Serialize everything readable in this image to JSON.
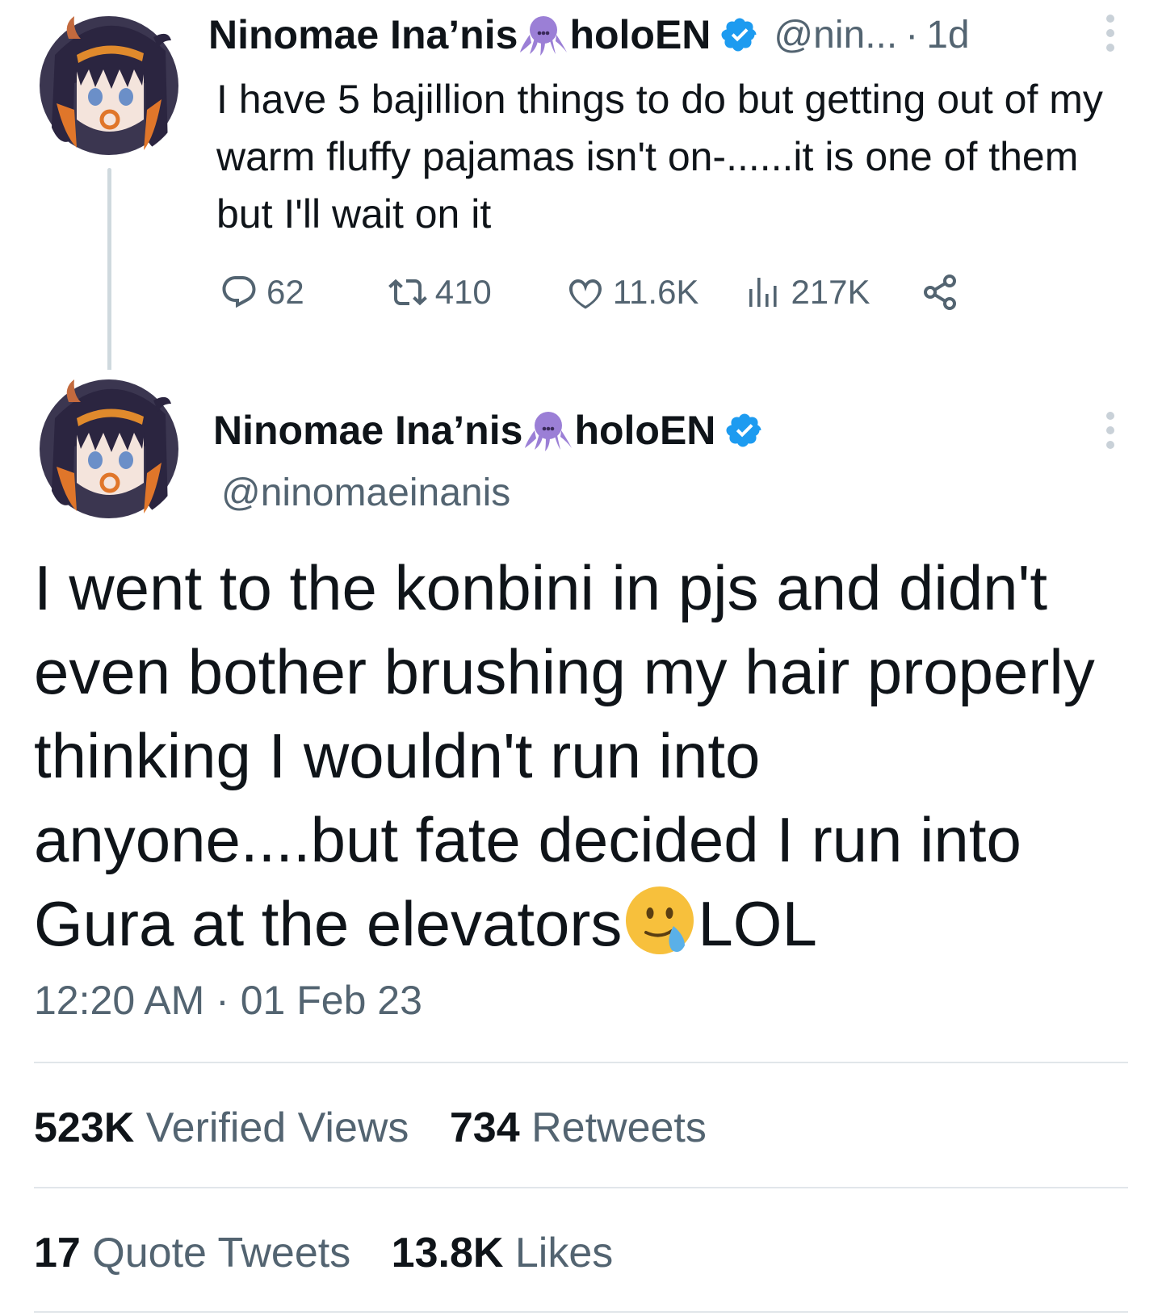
{
  "colors": {
    "text_primary": "#0f1419",
    "text_secondary": "#536471",
    "verified_blue": "#1d9bf0",
    "octopus_purple": "#9b7fd6",
    "divider": "#e1e6ea"
  },
  "author": {
    "display_name_part1": "Ninomae Ina’nis",
    "display_name_part2": "holoEN",
    "name_emoji": "octopus-emoji",
    "handle": "@ninomaeinanis",
    "handle_truncated": "@nin...",
    "verified": true
  },
  "reply_tweet": {
    "time_ago": "1d",
    "dot": "·",
    "text": "I have 5 bajillion things to do but getting out of my warm fluffy pajamas isn't on-......it is one of them but I'll wait on it",
    "actions": {
      "replies": "62",
      "retweets": "410",
      "likes": "11.6K",
      "views": "217K"
    }
  },
  "main_tweet": {
    "text_before_emoji": "I went to the konbini in pjs and didn't even bother brushing my hair properly thinking I wouldn't run into anyone....but fate decided I run into Gura at the elevators",
    "emoji": "face-holding-back-tears",
    "text_after_emoji": "LOL",
    "time": "12:20 AM",
    "dot": "·",
    "date": "01 Feb 23",
    "stats": {
      "views_count": "523K",
      "views_label": "Verified Views",
      "retweets_count": "734",
      "retweets_label": "Retweets",
      "quotes_count": "17",
      "quotes_label": "Quote Tweets",
      "likes_count": "13.8K",
      "likes_label": "Likes"
    }
  }
}
